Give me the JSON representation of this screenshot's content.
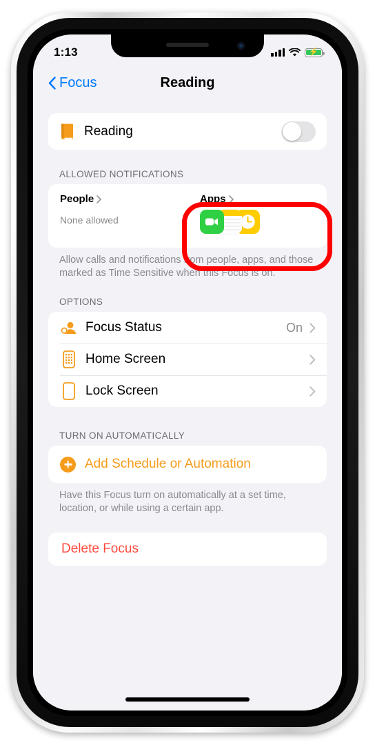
{
  "status_bar": {
    "time": "1:13",
    "signal_icon": "cellular-bars-icon",
    "wifi_icon": "wifi-icon",
    "battery_icon": "battery-charging-icon"
  },
  "nav": {
    "back_label": "Focus",
    "title": "Reading"
  },
  "master": {
    "icon": "book-icon",
    "label": "Reading",
    "toggle_state": "off"
  },
  "allowed_notifications": {
    "header": "ALLOWED NOTIFICATIONS",
    "people": {
      "title": "People",
      "subtitle": "None allowed"
    },
    "apps": {
      "title": "Apps",
      "app_icons": [
        "facetime-icon",
        "notes-icon",
        "clock-icon"
      ]
    },
    "footer": "Allow calls and notifications from people, apps, and those marked as Time Sensitive when this Focus is on."
  },
  "options": {
    "header": "OPTIONS",
    "rows": [
      {
        "icon": "focus-status-person-icon",
        "label": "Focus Status",
        "value": "On"
      },
      {
        "icon": "home-screen-icon",
        "label": "Home Screen",
        "value": ""
      },
      {
        "icon": "lock-screen-icon",
        "label": "Lock Screen",
        "value": ""
      }
    ]
  },
  "turn_on_automatically": {
    "header": "TURN ON AUTOMATICALLY",
    "add_label": "Add Schedule or Automation",
    "footer": "Have this Focus turn on automatically at a set time, location, or while using a certain app."
  },
  "delete": {
    "label": "Delete Focus"
  },
  "colors": {
    "accent_orange": "#f59c1c",
    "link_blue": "#007aff",
    "destructive_red": "#ff4b3e",
    "annotation_red": "#ff0000",
    "background": "#f2f2f7"
  }
}
